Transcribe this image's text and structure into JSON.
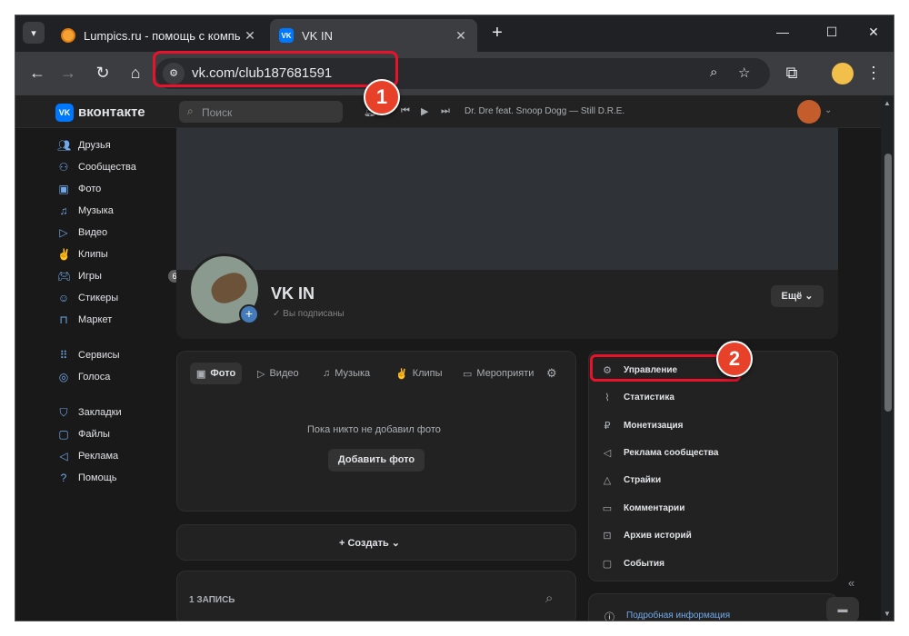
{
  "browser": {
    "tabs": [
      {
        "title": "Lumpics.ru - помощь с компь",
        "active": false
      },
      {
        "title": "VK IN",
        "active": true
      }
    ],
    "url": "vk.com/club187681591",
    "badges": {
      "one": "1",
      "two": "2"
    },
    "highlight_color": "#e8122a"
  },
  "vk": {
    "logo_text": "вконтакте",
    "search_placeholder": "Поиск",
    "now_playing": "Dr. Dre feat. Snoop Dogg — Still D.R.E.",
    "nav": [
      {
        "label": "Друзья",
        "icon": "friends-icon"
      },
      {
        "label": "Сообщества",
        "icon": "communities-icon"
      },
      {
        "label": "Фото",
        "icon": "photo-icon"
      },
      {
        "label": "Музыка",
        "icon": "music-icon"
      },
      {
        "label": "Видео",
        "icon": "video-icon"
      },
      {
        "label": "Клипы",
        "icon": "clips-icon"
      },
      {
        "label": "Игры",
        "icon": "games-icon",
        "count": "6"
      },
      {
        "label": "Стикеры",
        "icon": "stickers-icon"
      },
      {
        "label": "Маркет",
        "icon": "market-icon"
      },
      {
        "label": "Сервисы",
        "icon": "services-icon"
      },
      {
        "label": "Голоса",
        "icon": "votes-icon"
      },
      {
        "label": "Закладки",
        "icon": "bookmarks-icon"
      },
      {
        "label": "Файлы",
        "icon": "files-icon"
      },
      {
        "label": "Реклама",
        "icon": "ads-icon"
      },
      {
        "label": "Помощь",
        "icon": "help-icon"
      }
    ],
    "community": {
      "name": "VK IN",
      "status": "Вы подписаны",
      "more_label": "Ещё"
    },
    "photo_tabs": [
      "Фото",
      "Видео",
      "Музыка",
      "Клипы",
      "Мероприяти"
    ],
    "no_photos_text": "Пока никто не добавил фото",
    "add_photo_label": "Добавить фото",
    "create_label": "Создать",
    "posts_label": "1 ЗАПИСЬ",
    "manage_menu": [
      {
        "label": "Управление",
        "icon": "gear-icon"
      },
      {
        "label": "Статистика",
        "icon": "stats-icon"
      },
      {
        "label": "Монетизация",
        "icon": "money-icon"
      },
      {
        "label": "Реклама сообщества",
        "icon": "megaphone-icon"
      },
      {
        "label": "Страйки",
        "icon": "warning-icon"
      },
      {
        "label": "Комментарии",
        "icon": "comment-icon"
      },
      {
        "label": "Архив историй",
        "icon": "archive-icon"
      },
      {
        "label": "События",
        "icon": "events-icon"
      }
    ],
    "info_label": "Подробная информация"
  }
}
